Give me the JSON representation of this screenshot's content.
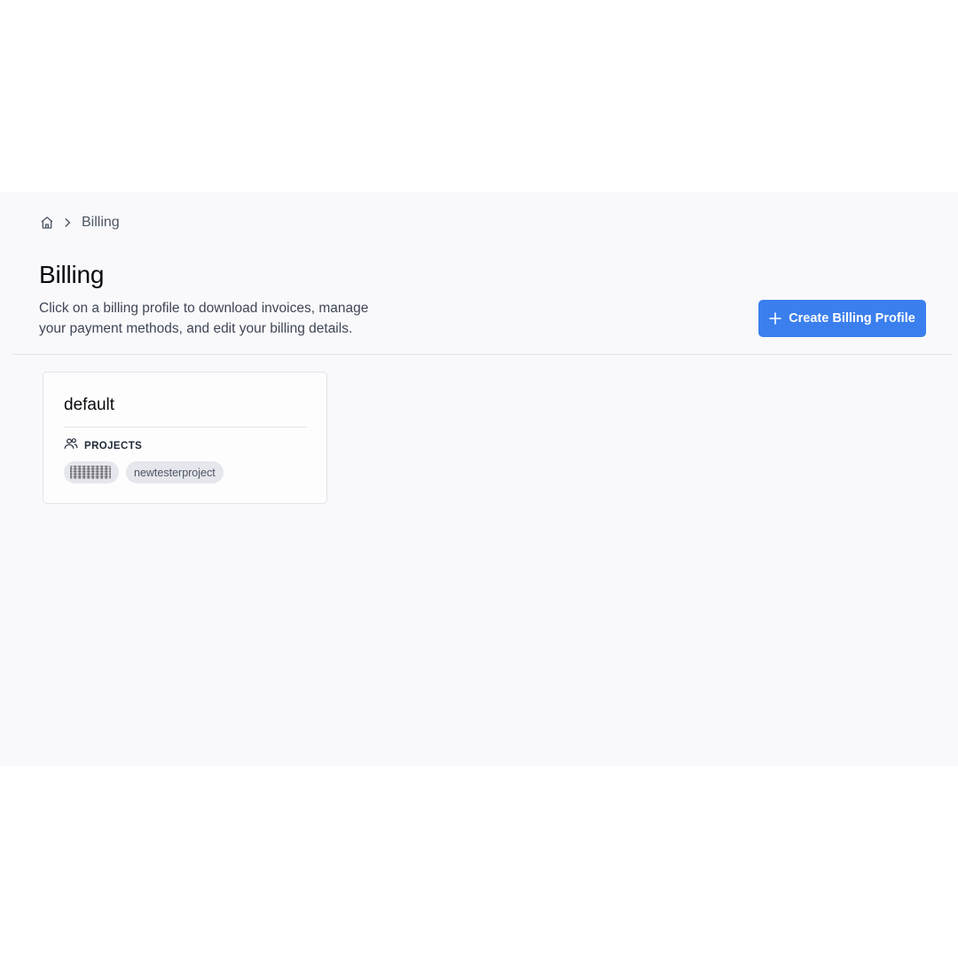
{
  "breadcrumb": {
    "home_icon": "home-icon",
    "separator_icon": "chevron-right-icon",
    "current": "Billing"
  },
  "header": {
    "title": "Billing",
    "description": "Click on a billing profile to download invoices, manage your payment methods, and edit your billing details.",
    "create_button": {
      "label": "Create Billing Profile",
      "icon": "plus-icon"
    }
  },
  "profiles": [
    {
      "name": "default",
      "projects_label": "PROJECTS",
      "projects_icon": "users-icon",
      "projects": [
        {
          "name": "",
          "redacted": true
        },
        {
          "name": "newtesterproject",
          "redacted": false
        }
      ]
    }
  ],
  "colors": {
    "accent": "#3b7fee",
    "page_background": "#f9f9fc",
    "chip_background": "#e6e7ec"
  }
}
